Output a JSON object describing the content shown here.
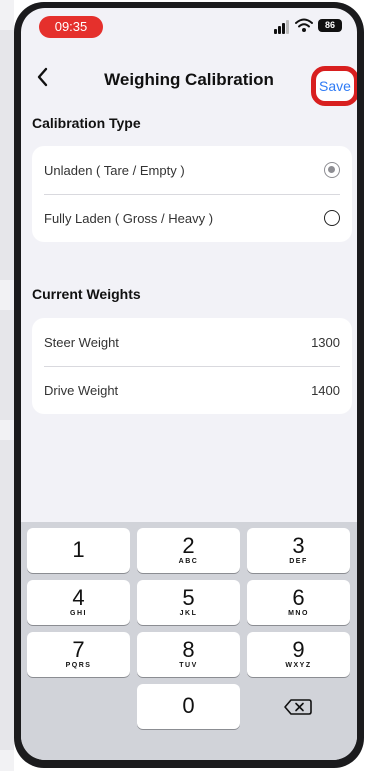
{
  "status": {
    "time": "09:35",
    "battery": "86"
  },
  "nav": {
    "title": "Weighing Calibration",
    "save_label": "Save"
  },
  "calibration": {
    "title": "Calibration Type",
    "options": [
      {
        "label": "Unladen ( Tare / Empty )",
        "selected": true
      },
      {
        "label": "Fully Laden ( Gross / Heavy )",
        "selected": false
      }
    ]
  },
  "weights": {
    "title": "Current Weights",
    "rows": [
      {
        "label": "Steer Weight",
        "value": "1300"
      },
      {
        "label": "Drive Weight",
        "value": "1400"
      }
    ]
  },
  "keypad": {
    "keys": [
      {
        "digit": "1",
        "letters": ""
      },
      {
        "digit": "2",
        "letters": "ABC"
      },
      {
        "digit": "3",
        "letters": "DEF"
      },
      {
        "digit": "4",
        "letters": "GHI"
      },
      {
        "digit": "5",
        "letters": "JKL"
      },
      {
        "digit": "6",
        "letters": "MNO"
      },
      {
        "digit": "7",
        "letters": "PQRS"
      },
      {
        "digit": "8",
        "letters": "TUV"
      },
      {
        "digit": "9",
        "letters": "WXYZ"
      },
      {
        "digit": "0",
        "letters": ""
      }
    ],
    "delete_icon": "delete-backspace-icon"
  },
  "colors": {
    "accent": "#2f7bf5",
    "highlight": "#d81f1f",
    "status_pill": "#e5302c"
  }
}
